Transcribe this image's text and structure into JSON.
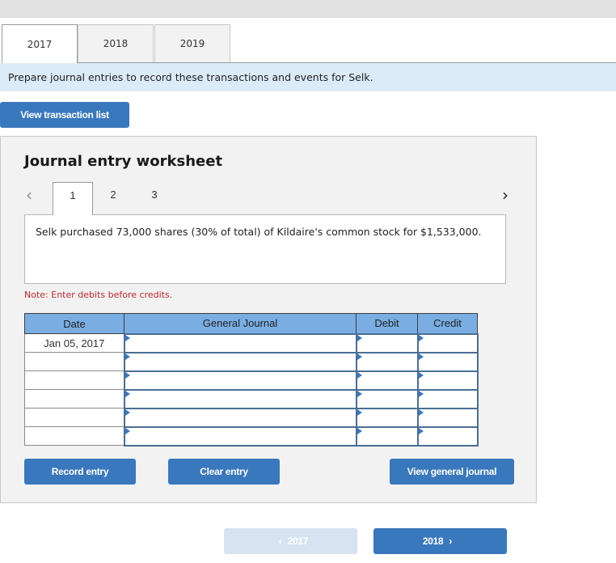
{
  "tabs": [
    {
      "label": "2017",
      "active": true
    },
    {
      "label": "2018",
      "active": false
    },
    {
      "label": "2019",
      "active": false
    }
  ],
  "instruction": "Prepare journal entries to record these transactions and events for Selk.",
  "view_transaction_list_label": "View transaction list",
  "worksheet": {
    "title": "Journal entry worksheet",
    "pager": {
      "prev_icon": "chevron-left-icon",
      "next_icon": "chevron-right-icon",
      "pages": [
        "1",
        "2",
        "3"
      ],
      "current": "1"
    },
    "description": "Selk purchased 73,000 shares (30% of total) of Kildaire's common stock for $1,533,000.",
    "note": "Note: Enter debits before credits.",
    "table": {
      "headers": [
        "Date",
        "General Journal",
        "Debit",
        "Credit"
      ],
      "rows": [
        {
          "date": "Jan 05, 2017",
          "account": "",
          "debit": "",
          "credit": ""
        },
        {
          "date": "",
          "account": "",
          "debit": "",
          "credit": ""
        },
        {
          "date": "",
          "account": "",
          "debit": "",
          "credit": ""
        },
        {
          "date": "",
          "account": "",
          "debit": "",
          "credit": ""
        },
        {
          "date": "",
          "account": "",
          "debit": "",
          "credit": ""
        },
        {
          "date": "",
          "account": "",
          "debit": "",
          "credit": ""
        }
      ]
    },
    "buttons": {
      "record": "Record entry",
      "clear": "Clear entry",
      "view_general_journal": "View general journal"
    }
  },
  "year_nav": {
    "prev_label": "2017",
    "next_label": "2018",
    "prev_icon": "chevron-left-icon",
    "next_icon": "chevron-right-icon"
  },
  "colors": {
    "primary_button": "#3a78bd",
    "disabled_button": "#d7e3f1",
    "table_header": "#7aaee3",
    "instruction_bg": "#dcebf8",
    "note_text": "#c0282d"
  }
}
